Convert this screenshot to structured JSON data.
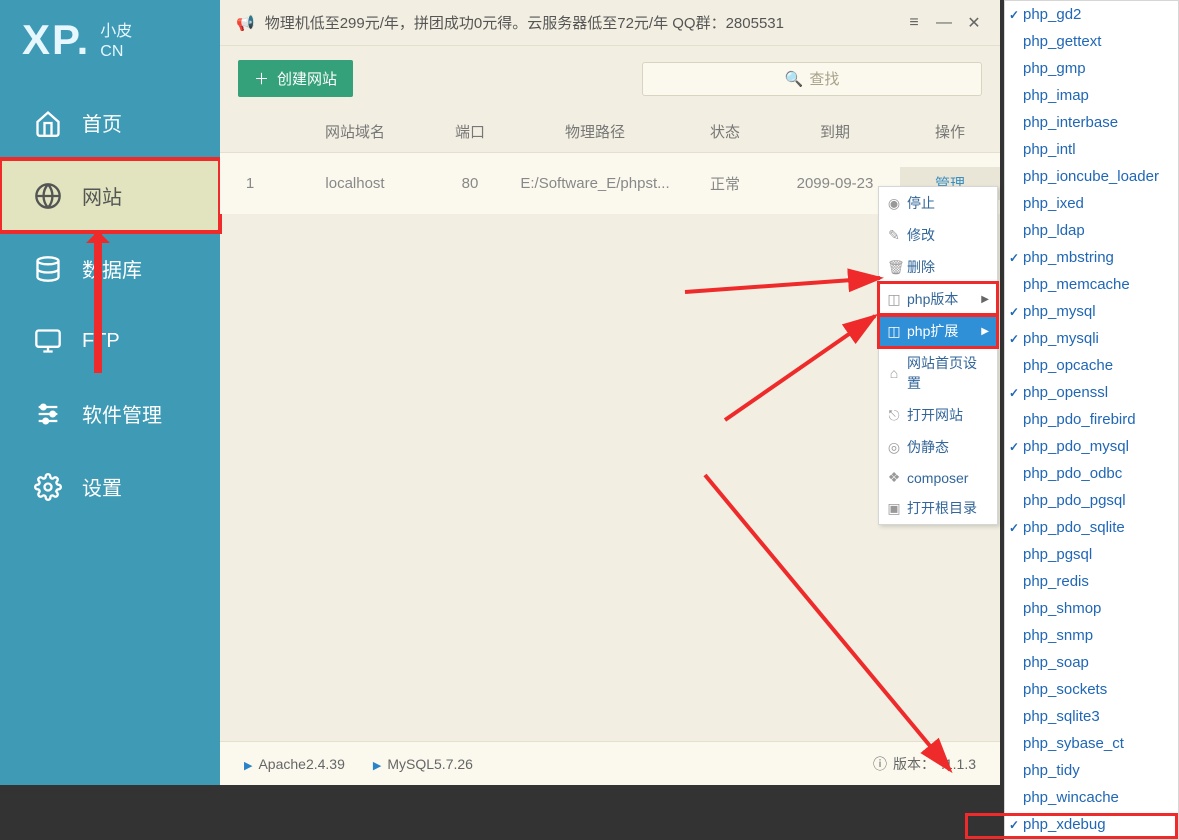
{
  "logo": {
    "main": "XP.",
    "sub1": "小皮",
    "sub2": "CN"
  },
  "nav": [
    {
      "id": "home",
      "label": "首页"
    },
    {
      "id": "site",
      "label": "网站"
    },
    {
      "id": "db",
      "label": "数据库"
    },
    {
      "id": "ftp",
      "label": "FTP"
    },
    {
      "id": "software",
      "label": "软件管理"
    },
    {
      "id": "settings",
      "label": "设置"
    }
  ],
  "topbar": {
    "announcement": "物理机低至299元/年，拼团成功0元得。云服务器低至72元/年  QQ群：2805531"
  },
  "actions": {
    "create": "创建网站",
    "search_placeholder": "查找"
  },
  "table": {
    "headers": {
      "col1": "",
      "col2": "网站域名",
      "col3": "端口",
      "col4": "物理路径",
      "col5": "状态",
      "col6": "到期",
      "col7": "操作"
    },
    "rows": [
      {
        "idx": "1",
        "domain": "localhost",
        "port": "80",
        "path": "E:/Software_E/phpst...",
        "status": "正常",
        "expire": "2099-09-23",
        "action": "管理"
      }
    ]
  },
  "menu": [
    {
      "id": "stop",
      "icon": "◉",
      "label": "停止"
    },
    {
      "id": "edit",
      "icon": "✎",
      "label": "修改"
    },
    {
      "id": "delete",
      "icon": "🗑",
      "label": "删除"
    },
    {
      "id": "phpver",
      "icon": "◫",
      "label": "php版本",
      "sub": true
    },
    {
      "id": "phpext",
      "icon": "◫",
      "label": "php扩展",
      "sub": true
    },
    {
      "id": "homeset",
      "icon": "⌂",
      "label": "网站首页设置"
    },
    {
      "id": "open",
      "icon": "⎋",
      "label": "打开网站"
    },
    {
      "id": "pseudo",
      "icon": "◎",
      "label": "伪静态"
    },
    {
      "id": "composer",
      "icon": "❖",
      "label": "composer"
    },
    {
      "id": "root",
      "icon": "▣",
      "label": "打开根目录"
    }
  ],
  "extensions": [
    {
      "name": "php_gd2",
      "checked": true
    },
    {
      "name": "php_gettext",
      "checked": false
    },
    {
      "name": "php_gmp",
      "checked": false
    },
    {
      "name": "php_imap",
      "checked": false
    },
    {
      "name": "php_interbase",
      "checked": false
    },
    {
      "name": "php_intl",
      "checked": false
    },
    {
      "name": "php_ioncube_loader",
      "checked": false
    },
    {
      "name": "php_ixed",
      "checked": false
    },
    {
      "name": "php_ldap",
      "checked": false
    },
    {
      "name": "php_mbstring",
      "checked": true
    },
    {
      "name": "php_memcache",
      "checked": false
    },
    {
      "name": "php_mysql",
      "checked": true
    },
    {
      "name": "php_mysqli",
      "checked": true
    },
    {
      "name": "php_opcache",
      "checked": false
    },
    {
      "name": "php_openssl",
      "checked": true
    },
    {
      "name": "php_pdo_firebird",
      "checked": false
    },
    {
      "name": "php_pdo_mysql",
      "checked": true
    },
    {
      "name": "php_pdo_odbc",
      "checked": false
    },
    {
      "name": "php_pdo_pgsql",
      "checked": false
    },
    {
      "name": "php_pdo_sqlite",
      "checked": true
    },
    {
      "name": "php_pgsql",
      "checked": false
    },
    {
      "name": "php_redis",
      "checked": false
    },
    {
      "name": "php_shmop",
      "checked": false
    },
    {
      "name": "php_snmp",
      "checked": false
    },
    {
      "name": "php_soap",
      "checked": false
    },
    {
      "name": "php_sockets",
      "checked": false
    },
    {
      "name": "php_sqlite3",
      "checked": false
    },
    {
      "name": "php_sybase_ct",
      "checked": false
    },
    {
      "name": "php_tidy",
      "checked": false
    },
    {
      "name": "php_wincache",
      "checked": false
    },
    {
      "name": "php_xdebug",
      "checked": true
    }
  ],
  "footer": {
    "apache": "Apache2.4.39",
    "mysql": "MySQL5.7.26",
    "version_label": "版本：",
    "version": ".1.1.3"
  },
  "annotations": {
    "color": "#ee2a2a"
  }
}
